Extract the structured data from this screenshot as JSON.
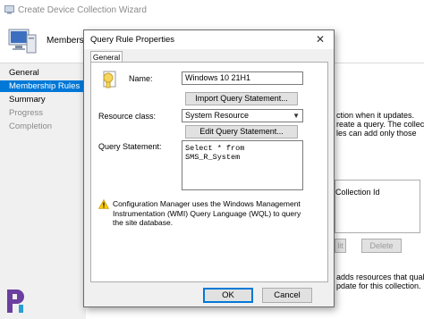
{
  "wizard": {
    "title": "Create Device Collection Wizard",
    "header": "Membership",
    "nav": [
      "General",
      "Membership Rules",
      "Summary",
      "Progress",
      "Completion"
    ],
    "bg_text_1": "ction when it updates.",
    "bg_text_2": "reate a query. The collection",
    "bg_text_3": "les can add only those",
    "table_header": "Collection Id",
    "edit_button": "lit",
    "delete_button": "Delete",
    "bg_text_4": "adds resources that qualify",
    "bg_text_5": "pdate for this collection."
  },
  "dialog": {
    "title": "Query Rule Properties",
    "close_glyph": "✕",
    "tab": "General",
    "name_label": "Name:",
    "name_value": "Windows 10 21H1",
    "import_button": "Import Query Statement...",
    "resource_class_label": "Resource class:",
    "resource_class_value": "System Resource",
    "edit_query_button": "Edit Query Statement...",
    "query_statement_label": "Query Statement:",
    "query_statement_value": "Select * from\nSMS_R_System",
    "warning_text": "Configuration Manager uses the Windows Management Instrumentation (WMI) Query Language (WQL) to query the site database.",
    "ok_button": "OK",
    "cancel_button": "Cancel"
  },
  "icons": {
    "warning": "warning-icon",
    "query": "query-rule-icon",
    "computer": "computer-icon",
    "logo": "prajwal-logo"
  },
  "colors": {
    "accent": "#0078d7",
    "logo": "#6a3fa0"
  }
}
